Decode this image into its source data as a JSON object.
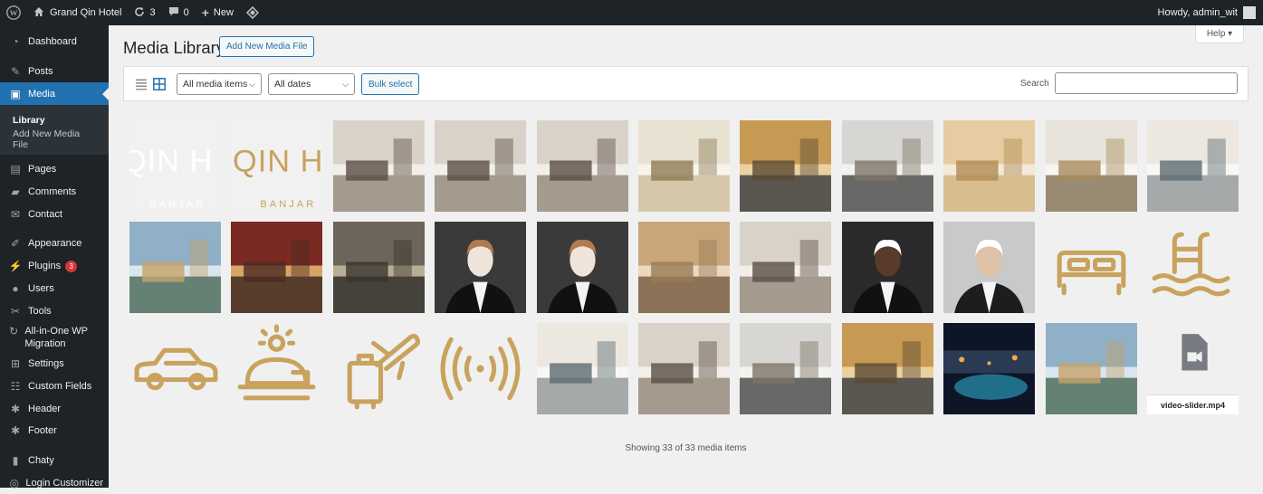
{
  "adminbar": {
    "site_name": "Grand Qin Hotel",
    "updates_count": "3",
    "comments_count": "0",
    "new_label": "New",
    "greeting": "Howdy, admin_wit"
  },
  "sidebar": {
    "items": [
      {
        "label": "Dashboard",
        "icon": "dashboard-icon"
      },
      {
        "label": "Posts",
        "icon": "pin-icon"
      },
      {
        "label": "Media",
        "icon": "media-icon"
      },
      {
        "label": "Pages",
        "icon": "pages-icon"
      },
      {
        "label": "Comments",
        "icon": "comments-icon"
      },
      {
        "label": "Contact",
        "icon": "mail-icon"
      },
      {
        "label": "Appearance",
        "icon": "brush-icon"
      },
      {
        "label": "Plugins",
        "icon": "plugin-icon",
        "badge": "3"
      },
      {
        "label": "Users",
        "icon": "users-icon"
      },
      {
        "label": "Tools",
        "icon": "wrench-icon"
      },
      {
        "label": "All-in-One WP Migration",
        "icon": "migration-icon"
      },
      {
        "label": "Settings",
        "icon": "settings-icon"
      },
      {
        "label": "Custom Fields",
        "icon": "fields-icon"
      },
      {
        "label": "Header",
        "icon": "gear-icon"
      },
      {
        "label": "Footer",
        "icon": "gear-icon"
      },
      {
        "label": "Chaty",
        "icon": "chat-icon"
      },
      {
        "label": "Login Customizer",
        "icon": "customizer-icon"
      }
    ],
    "submenu": [
      "Library",
      "Add New Media File"
    ]
  },
  "help_label": "Help ▾",
  "page": {
    "title": "Media Library",
    "add_new_label": "Add New Media File"
  },
  "toolbar": {
    "filter_type": "All media items",
    "filter_date": "All dates",
    "bulk_label": "Bulk select",
    "search_label": "Search",
    "search_value": ""
  },
  "media_items": [
    {
      "kind": "logo",
      "text1": "QIN H",
      "text2": "BANJAR"
    },
    {
      "kind": "logo",
      "text1": "QIN H",
      "text2": "BANJAR"
    },
    {
      "kind": "photo",
      "subject": "bedroom"
    },
    {
      "kind": "photo",
      "subject": "bedroom"
    },
    {
      "kind": "photo",
      "subject": "bedroom"
    },
    {
      "kind": "photo",
      "subject": "lobby"
    },
    {
      "kind": "photo",
      "subject": "ballroom"
    },
    {
      "kind": "photo",
      "subject": "gym"
    },
    {
      "kind": "photo",
      "subject": "marble-hall"
    },
    {
      "kind": "photo",
      "subject": "restaurant"
    },
    {
      "kind": "photo",
      "subject": "buffet"
    },
    {
      "kind": "photo",
      "subject": "garden-lounge"
    },
    {
      "kind": "photo",
      "subject": "banquet"
    },
    {
      "kind": "photo",
      "subject": "meeting-room"
    },
    {
      "kind": "photo",
      "subject": "receptionist"
    },
    {
      "kind": "photo",
      "subject": "receptionist"
    },
    {
      "kind": "photo",
      "subject": "lounge"
    },
    {
      "kind": "photo",
      "subject": "bedroom"
    },
    {
      "kind": "photo",
      "subject": "staff-man"
    },
    {
      "kind": "photo",
      "subject": "man-portrait"
    },
    {
      "kind": "icon",
      "icon": "bed-icon"
    },
    {
      "kind": "icon",
      "icon": "pool-icon"
    },
    {
      "kind": "icon",
      "icon": "car-icon"
    },
    {
      "kind": "icon",
      "icon": "room-service-icon"
    },
    {
      "kind": "icon",
      "icon": "luggage-plane-icon"
    },
    {
      "kind": "icon",
      "icon": "wifi-signal-icon"
    },
    {
      "kind": "photo",
      "subject": "buffet"
    },
    {
      "kind": "photo",
      "subject": "bedroom"
    },
    {
      "kind": "photo",
      "subject": "gym"
    },
    {
      "kind": "photo",
      "subject": "ballroom"
    },
    {
      "kind": "photo",
      "subject": "pool-night"
    },
    {
      "kind": "photo",
      "subject": "garden-lounge"
    },
    {
      "kind": "file",
      "icon": "video-file-icon",
      "filename": "video-slider.mp4"
    }
  ],
  "count_text": "Showing 33 of 33 media items",
  "colors": {
    "accent": "#2271b1",
    "gold": "#c9a25e",
    "sidebar_bg": "#1d2327",
    "badge": "#d63638"
  }
}
